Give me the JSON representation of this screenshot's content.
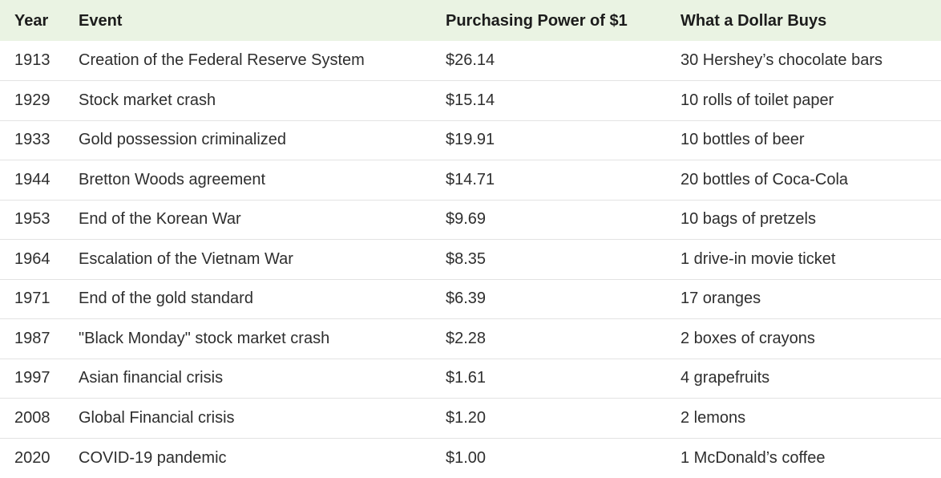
{
  "table": {
    "headers": {
      "year": "Year",
      "event": "Event",
      "power": "Purchasing Power of $1",
      "buys": "What a Dollar Buys"
    },
    "rows": [
      {
        "year": "1913",
        "event": "Creation of the Federal Reserve System",
        "power": "$26.14",
        "buys": "30 Hershey’s chocolate bars"
      },
      {
        "year": "1929",
        "event": "Stock market crash",
        "power": "$15.14",
        "buys": "10 rolls of toilet paper"
      },
      {
        "year": "1933",
        "event": "Gold possession criminalized",
        "power": "$19.91",
        "buys": "10 bottles of beer"
      },
      {
        "year": "1944",
        "event": "Bretton Woods agreement",
        "power": "$14.71",
        "buys": "20 bottles of Coca-Cola"
      },
      {
        "year": "1953",
        "event": "End of the Korean War",
        "power": "$9.69",
        "buys": "10 bags of pretzels"
      },
      {
        "year": "1964",
        "event": "Escalation of the Vietnam War",
        "power": "$8.35",
        "buys": "1 drive-in movie ticket"
      },
      {
        "year": "1971",
        "event": "End of the gold standard",
        "power": "$6.39",
        "buys": "17 oranges"
      },
      {
        "year": "1987",
        "event": "\"Black Monday\" stock market crash",
        "power": "$2.28",
        "buys": "2 boxes of crayons"
      },
      {
        "year": "1997",
        "event": "Asian financial crisis",
        "power": "$1.61",
        "buys": "4 grapefruits"
      },
      {
        "year": "2008",
        "event": "Global Financial crisis",
        "power": "$1.20",
        "buys": "2 lemons"
      },
      {
        "year": "2020",
        "event": "COVID-19 pandemic",
        "power": "$1.00",
        "buys": "1 McDonald’s coffee"
      }
    ]
  },
  "colors": {
    "header_bg": "#eaf3e3",
    "row_divider": "#e3e3e3",
    "text": "#2e2e2e"
  }
}
